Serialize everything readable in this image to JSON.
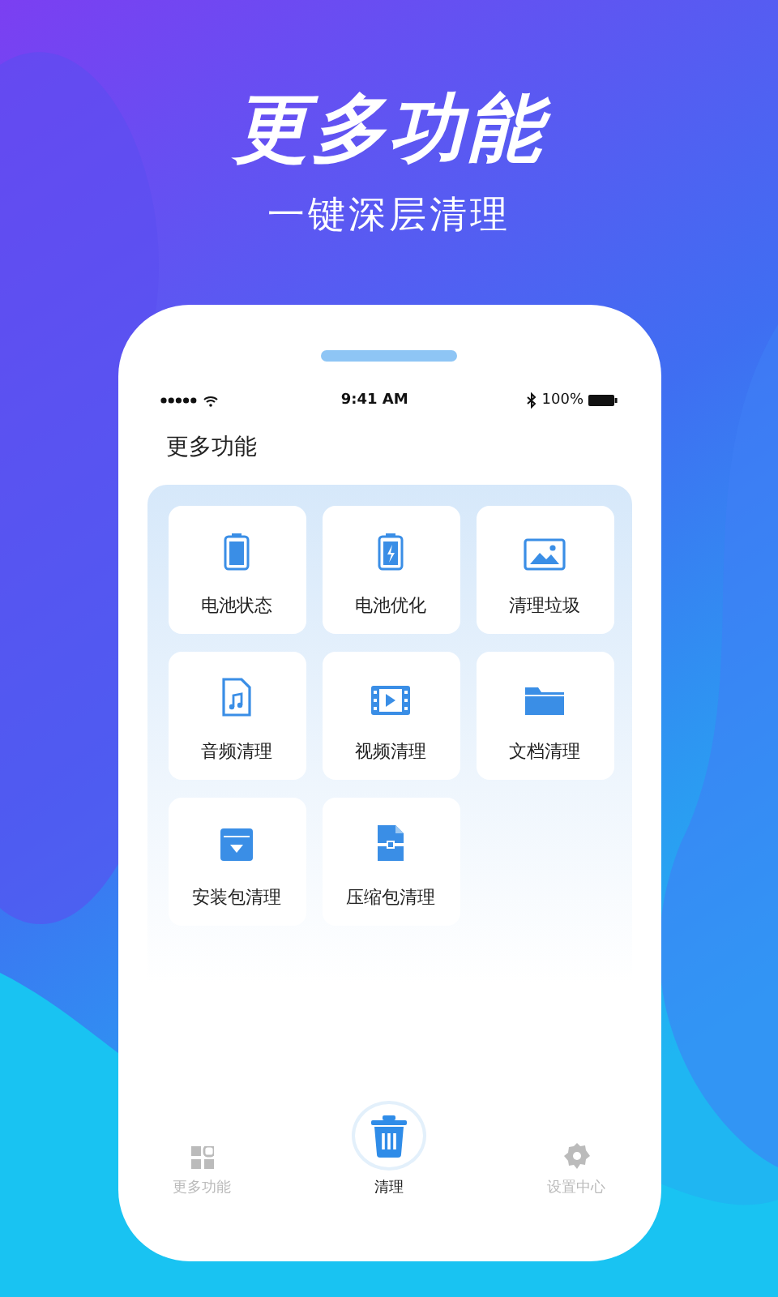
{
  "headline": {
    "title": "更多功能",
    "subtitle": "一键深层清理"
  },
  "status_bar": {
    "time": "9:41 AM",
    "battery": "100%"
  },
  "page_title": "更多功能",
  "tiles": [
    {
      "label": "电池状态"
    },
    {
      "label": "电池优化"
    },
    {
      "label": "清理垃圾"
    },
    {
      "label": "音频清理"
    },
    {
      "label": "视频清理"
    },
    {
      "label": "文档清理"
    },
    {
      "label": "安装包清理"
    },
    {
      "label": "压缩包清理"
    }
  ],
  "nav": [
    {
      "label": "更多功能",
      "selected": false
    },
    {
      "label": "清理",
      "selected": true
    },
    {
      "label": "设置中心",
      "selected": false
    }
  ]
}
